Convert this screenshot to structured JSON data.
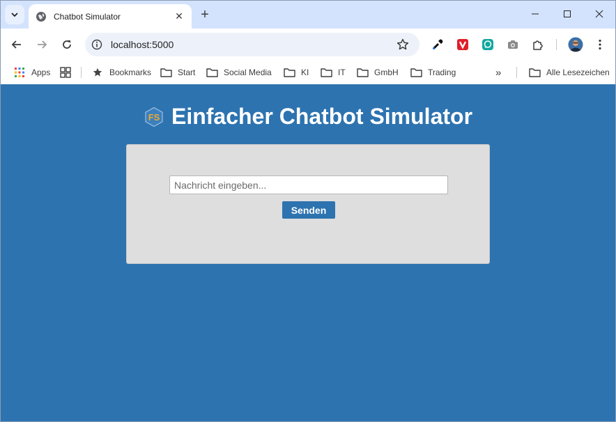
{
  "browser": {
    "tab": {
      "title": "Chatbot Simulator"
    },
    "address": {
      "url": "localhost:5000"
    },
    "bookmarks": [
      {
        "label": "Apps",
        "icon": "apps-grid-icon"
      },
      {
        "label": "Bookmarks",
        "icon": "star-icon"
      },
      {
        "label": "Start",
        "icon": "folder-icon"
      },
      {
        "label": "Social Media",
        "icon": "folder-icon"
      },
      {
        "label": "KI",
        "icon": "folder-icon"
      },
      {
        "label": "IT",
        "icon": "folder-icon"
      },
      {
        "label": "GmbH",
        "icon": "folder-icon"
      },
      {
        "label": "Trading",
        "icon": "folder-icon"
      }
    ],
    "bookmarks_overflow": "»",
    "all_bookmarks": "Alle Lesezeichen"
  },
  "page": {
    "logo_text": "FS",
    "title": "Einfacher Chatbot Simulator",
    "input": {
      "placeholder": "Nachricht eingeben...",
      "value": ""
    },
    "send_label": "Senden"
  },
  "colors": {
    "page_background": "#2d73b0",
    "card_background": "#dedede",
    "button": "#2d73b0",
    "logo_accent": "#f0a830"
  }
}
